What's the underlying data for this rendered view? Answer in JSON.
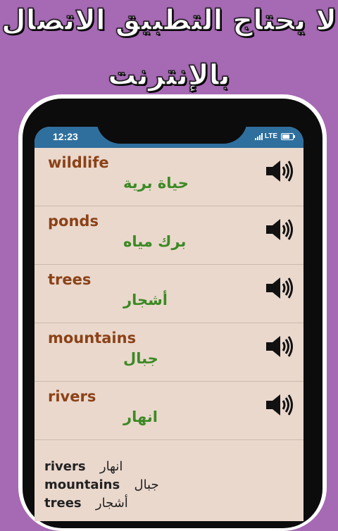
{
  "banner": {
    "line1": "لا يحتاج التطبيق الاتصال",
    "line2": "بالإنترنت"
  },
  "status_bar": {
    "time": "12:23",
    "network": "LTE"
  },
  "words": [
    {
      "en": "wildlife",
      "ar": "حياة برية"
    },
    {
      "en": "ponds",
      "ar": "برك مياه"
    },
    {
      "en": "trees",
      "ar": "أشجار"
    },
    {
      "en": "mountains",
      "ar": "جبال"
    },
    {
      "en": "rivers",
      "ar": "انهار"
    }
  ],
  "summary": [
    {
      "en": "rivers",
      "ar": "انهار"
    },
    {
      "en": "mountains",
      "ar": "جبال"
    },
    {
      "en": "trees",
      "ar": "أشجار"
    }
  ],
  "icons": {
    "play": "speaker-icon"
  },
  "colors": {
    "background": "#a669b4",
    "english_word": "#8b4217",
    "arabic_word": "#3b8a24",
    "status_bar": "#2f6f9e",
    "screen": "#ead8cd"
  }
}
